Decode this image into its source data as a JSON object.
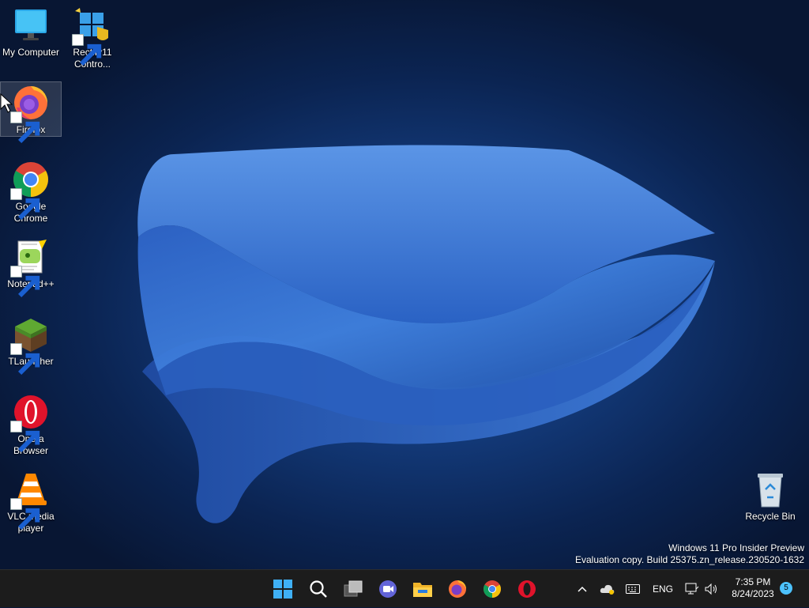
{
  "desktop": {
    "icons": [
      {
        "label": "My Computer",
        "icon": "monitor-icon"
      },
      {
        "label": "Rectify11 Contro...",
        "icon": "control-panel-icon"
      },
      {
        "label": "Firefox",
        "icon": "firefox-icon"
      },
      {
        "label": "Google Chrome",
        "icon": "chrome-icon"
      },
      {
        "label": "Notepad++",
        "icon": "notepadpp-icon"
      },
      {
        "label": "TLauncher",
        "icon": "tlauncher-icon"
      },
      {
        "label": "Opera Browser",
        "icon": "opera-icon"
      },
      {
        "label": "VLC media player",
        "icon": "vlc-icon"
      },
      {
        "label": "Recycle Bin",
        "icon": "recycle-bin-icon"
      }
    ],
    "watermark": {
      "line1": "Windows 11 Pro Insider Preview",
      "line2": "Evaluation copy. Build 25375.zn_release.230520-1632"
    }
  },
  "taskbar": {
    "pinned": [
      "start-icon",
      "search-icon",
      "task-view-icon",
      "chat-icon",
      "file-explorer-icon",
      "firefox-icon",
      "chrome-icon",
      "opera-icon"
    ],
    "tray": {
      "language": "ENG",
      "time": "7:35 PM",
      "date": "8/24/2023",
      "notification_count": "5"
    }
  },
  "colors": {
    "taskbar_bg": "#1c1c1c",
    "desktop_bg": "#0b2452",
    "bloom_blue": "#3b78d8",
    "accent": "#4cc2ff"
  }
}
